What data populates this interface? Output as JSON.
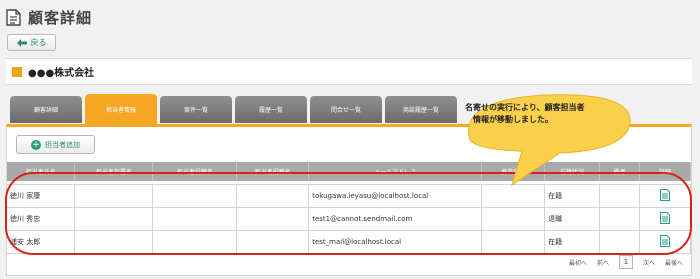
{
  "page": {
    "title": "顧客詳細",
    "back_label": "戻る"
  },
  "company": {
    "name": "●●●株式会社"
  },
  "tabs": [
    {
      "label": "顧客詳細",
      "active": false
    },
    {
      "label": "担当者情報",
      "active": true
    },
    {
      "label": "案件一覧",
      "active": false
    },
    {
      "label": "履歴一覧",
      "active": false
    },
    {
      "label": "問合せ一覧",
      "active": false
    },
    {
      "label": "商談履歴一覧",
      "active": false
    }
  ],
  "panel": {
    "add_label": "担当者追加"
  },
  "table": {
    "headers": [
      "担当者氏名",
      "担当者部署名",
      "担当者役職名",
      "担当者役職名",
      "メールアドレス",
      "携帯番号",
      "在籍状況",
      "備考",
      "詳細"
    ],
    "rows": [
      {
        "name": "徳川 家康",
        "email": "tokugawa.ieyasu@localhost.local",
        "status": "在籍"
      },
      {
        "name": "徳川 秀忠",
        "email": "test1@cannot.sendmail.com",
        "status": "退職"
      },
      {
        "name": "浦安 太郎",
        "email": "test_mail@localhost.local",
        "status": "在籍"
      }
    ]
  },
  "pager": {
    "first": "最初へ",
    "prev": "前へ",
    "current": "1",
    "next": "次へ",
    "last": "最後へ"
  },
  "callout": {
    "line1": "名寄せの実行により、顧客担当者",
    "line2": "情報が移動しました。"
  },
  "colors": {
    "accent": "#f5a623",
    "callout": "#fbd04a",
    "highlight": "#d6221b",
    "link": "#2a8a76"
  }
}
